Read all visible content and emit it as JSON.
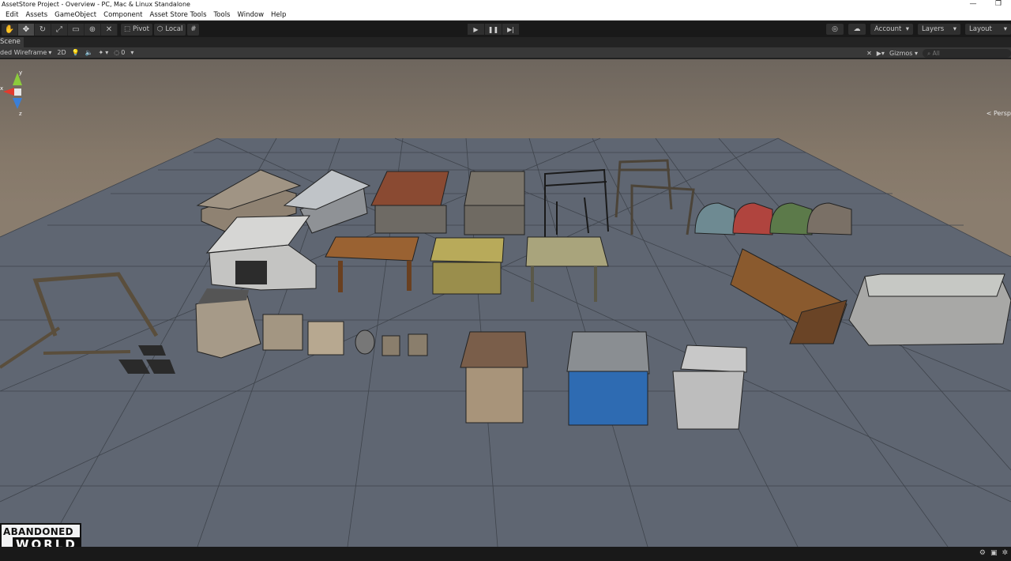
{
  "window": {
    "title": "AssetStore Project - Overview - PC, Mac & Linux Standalone",
    "minimize": "—",
    "restore": "❐"
  },
  "menu": [
    "Edit",
    "Assets",
    "GameObject",
    "Component",
    "Asset Store Tools",
    "Tools",
    "Window",
    "Help"
  ],
  "toolbar": {
    "pivot_label": "Pivot",
    "local_label": "Local",
    "account_label": "Account",
    "layers_label": "Layers",
    "layout_label": "Layout",
    "dropdown_glyph": "▾"
  },
  "scene": {
    "tab_label": "Scene",
    "shading_mode": "ded Wireframe",
    "mode_2d": "2D",
    "hidden_count": "0",
    "gizmos_label": "Gizmos",
    "search_placeholder": "All",
    "view_label": "< Persp"
  },
  "gizmo_axes": {
    "x": "x",
    "y": "y",
    "z": "z"
  },
  "logo": {
    "line1": "ABANDONED",
    "line2": "WORLD"
  },
  "colors": {
    "ground": "#5d6470",
    "sky": "#857869",
    "ui_dark": "#191919",
    "axis_x": "#e23b2e",
    "axis_y": "#8ccc3c",
    "axis_z": "#3a7fd8"
  }
}
